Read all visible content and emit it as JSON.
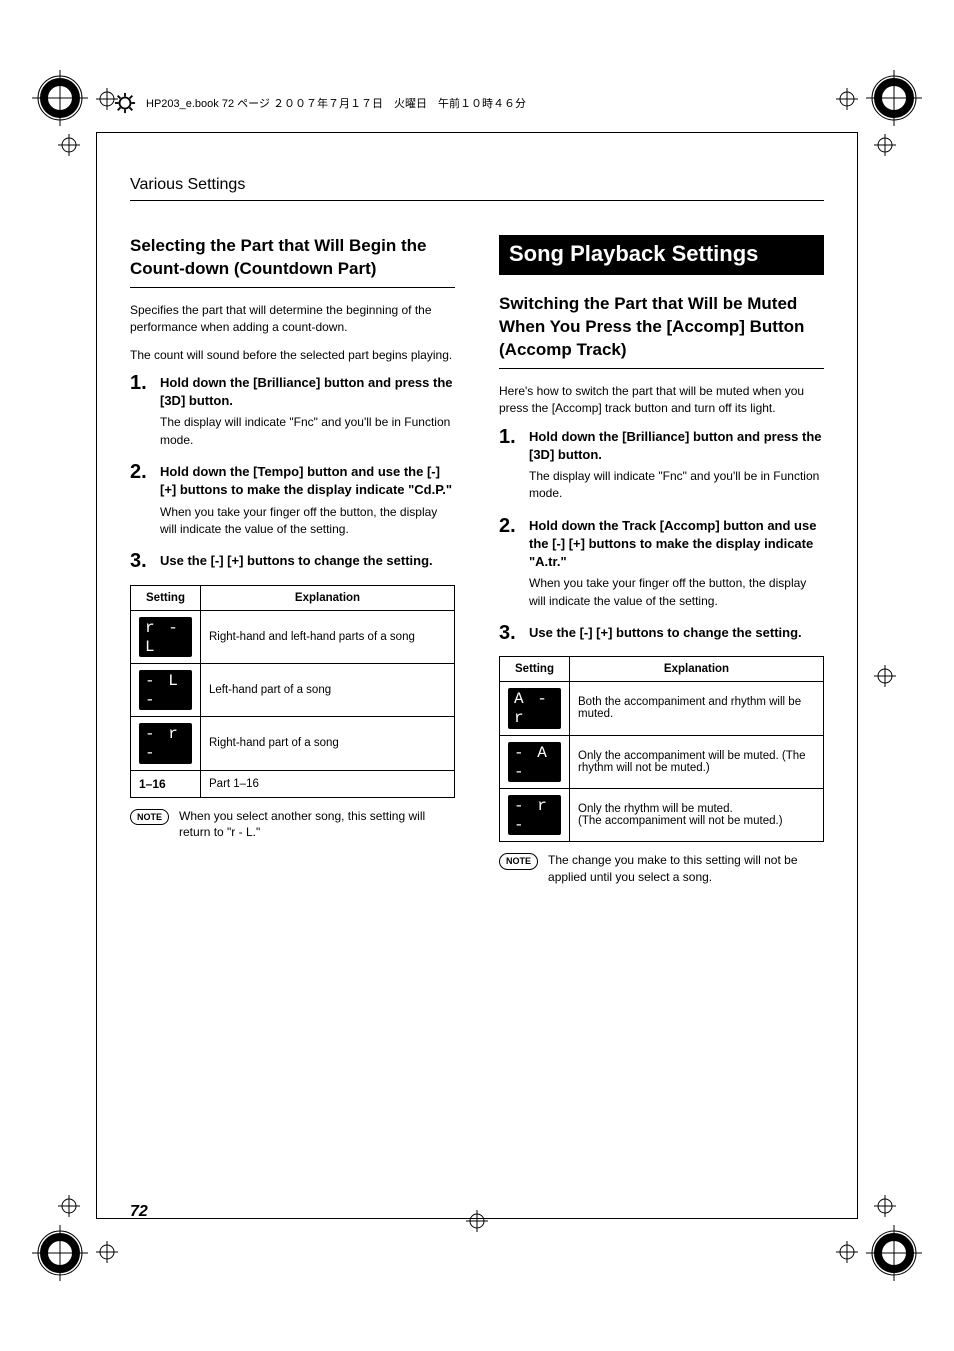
{
  "header": {
    "running_title": "Various Settings",
    "print_header": "HP203_e.book  72 ページ  ２００７年７月１７日　火曜日　午前１０時４６分"
  },
  "page_number": "72",
  "left": {
    "h3": "Selecting the Part that Will Begin the Count-down (Countdown Part)",
    "intro1": "Specifies the part that will determine the beginning of the performance when adding a count-down.",
    "intro2": "The count will sound before the selected part begins playing.",
    "steps": [
      {
        "title": "Hold down the [Brilliance] button and press the [3D] button.",
        "body": "The display will indicate \"Fnc\" and you'll be in Function mode."
      },
      {
        "title": "Hold down the [Tempo] button and use the [-] [+] buttons to make the display indicate \"Cd.P.\"",
        "body": "When you take your finger off the button, the display will indicate the value of the setting."
      },
      {
        "title": "Use the [-] [+] buttons to change the setting.",
        "body": ""
      }
    ],
    "table": {
      "headers": [
        "Setting",
        "Explanation"
      ],
      "rows": [
        {
          "seg": "r - L",
          "plain": "",
          "exp": "Right-hand and left-hand parts of a song"
        },
        {
          "seg": "- L -",
          "plain": "",
          "exp": "Left-hand part of a song"
        },
        {
          "seg": "- r -",
          "plain": "",
          "exp": "Right-hand part of a song"
        },
        {
          "seg": "",
          "plain": "1–16",
          "exp": "Part 1–16"
        }
      ]
    },
    "note": "When you select another song, this setting will return to \"r - L.\""
  },
  "right": {
    "h2": "Song Playback Settings",
    "h3": "Switching the Part that Will be Muted When You Press the [Accomp] Button (Accomp Track)",
    "intro": "Here's how to switch the part that will be muted when you press the [Accomp] track button and turn off its light.",
    "steps": [
      {
        "title": "Hold down the [Brilliance] button and press the [3D] button.",
        "body": "The display will indicate \"Fnc\" and you'll be in Function mode."
      },
      {
        "title": "Hold down the Track [Accomp] button and use the [-] [+] buttons to make the display indicate \"A.tr.\"",
        "body": "When you take your finger off the button, the display will indicate the value of the setting."
      },
      {
        "title": "Use the [-] [+] buttons to change the setting.",
        "body": ""
      }
    ],
    "table": {
      "headers": [
        "Setting",
        "Explanation"
      ],
      "rows": [
        {
          "seg": "A - r",
          "exp": "Both the accompaniment and rhythm will be muted."
        },
        {
          "seg": "- A -",
          "exp": "Only the accompaniment will be muted. (The rhythm will not be muted.)"
        },
        {
          "seg": "- r -",
          "exp": "Only the rhythm will be muted.\n(The accompaniment will not be muted.)"
        }
      ]
    },
    "note": "The change you make to this setting will not be applied until you select a song."
  },
  "labels": {
    "note": "NOTE"
  }
}
